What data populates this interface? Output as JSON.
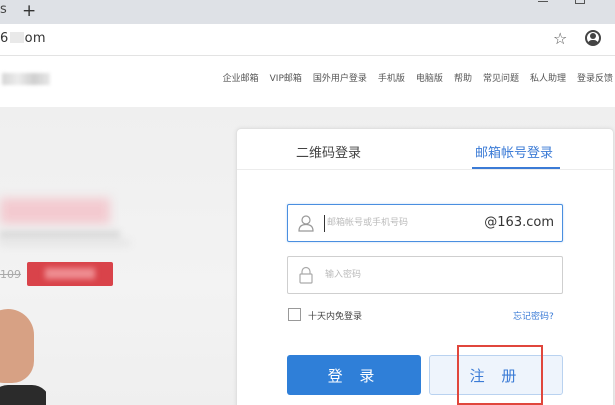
{
  "browser": {
    "tab_fragment": "s",
    "new_tab_label": "+",
    "url_start": "6",
    "url_end": "om",
    "star_icon": "star-icon",
    "account_icon": "account-icon"
  },
  "header": {
    "nav": [
      "企业邮箱",
      "VIP邮箱",
      "国外用户登录",
      "手机版",
      "电脑版",
      "帮助",
      "常见问题",
      "私人助理",
      "登录反馈"
    ]
  },
  "hero": {
    "old_price": "109"
  },
  "login": {
    "tab_qr": "二维码登录",
    "tab_email": "邮箱帐号登录",
    "email_placeholder": "邮箱帐号或手机号码",
    "email_suffix": "@163.com",
    "password_placeholder": "输入密码",
    "remember_label": "十天内免登录",
    "forgot_label": "忘记密码?",
    "login_button": "登 录",
    "register_button": "注 册"
  },
  "colors": {
    "accent": "#2f7fd8",
    "link": "#3b7bd6",
    "annotation": "#e0463c"
  }
}
